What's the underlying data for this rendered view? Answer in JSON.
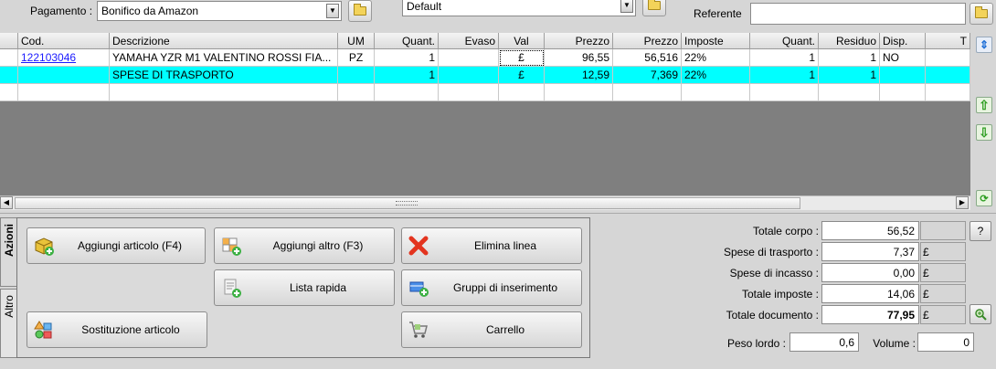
{
  "header": {
    "pagamento_label": "Pagamento :",
    "pagamento_value": "Bonifico da Amazon",
    "listino_value": "Default",
    "referente_label": "Referente",
    "referente_value": ""
  },
  "grid": {
    "columns": [
      "Cod.",
      "Descrizione",
      "UM",
      "Quant.",
      "Evaso",
      "Val",
      "Prezzo",
      "Prezzo",
      "Imposte",
      "Quant.",
      "Residuo",
      "Disp.",
      "T"
    ],
    "rows": [
      {
        "cod": "122103046",
        "descrizione": "YAMAHA YZR M1 VALENTINO ROSSI FIA...",
        "um": "PZ",
        "quant": "1",
        "evaso": "",
        "val": "£",
        "prezzo1": "96,55",
        "prezzo2": "56,516",
        "imposte": "22%",
        "quant2": "1",
        "residuo": "1",
        "disp": "NO"
      },
      {
        "cod": "",
        "descrizione": "SPESE DI TRASPORTO",
        "um": "",
        "quant": "1",
        "evaso": "",
        "val": "£",
        "prezzo1": "12,59",
        "prezzo2": "7,369",
        "imposte": "22%",
        "quant2": "1",
        "residuo": "1",
        "disp": ""
      }
    ]
  },
  "tabs": {
    "azioni": "Azioni",
    "altro": "Altro"
  },
  "actions": {
    "aggiungi_articolo": "Aggiungi articolo (F4)",
    "aggiungi_altro": "Aggiungi altro (F3)",
    "elimina_linea": "Elimina linea",
    "lista_rapida": "Lista rapida",
    "gruppi_inserimento": "Gruppi di inserimento",
    "sostituzione_articolo": "Sostituzione articolo",
    "carrello": "Carrello"
  },
  "totals": {
    "totale_corpo_label": "Totale corpo :",
    "totale_corpo": "56,52",
    "spese_trasporto_label": "Spese di trasporto :",
    "spese_trasporto": "7,37",
    "spese_incasso_label": "Spese di incasso :",
    "spese_incasso": "0,00",
    "totale_imposte_label": "Totale imposte :",
    "totale_imposte": "14,06",
    "totale_documento_label": "Totale documento :",
    "totale_documento": "77,95",
    "currency": "£",
    "help_button": "?",
    "peso_lordo_label": "Peso lordo :",
    "peso_lordo": "0,6",
    "volume_label": "Volume :",
    "volume": "0"
  }
}
